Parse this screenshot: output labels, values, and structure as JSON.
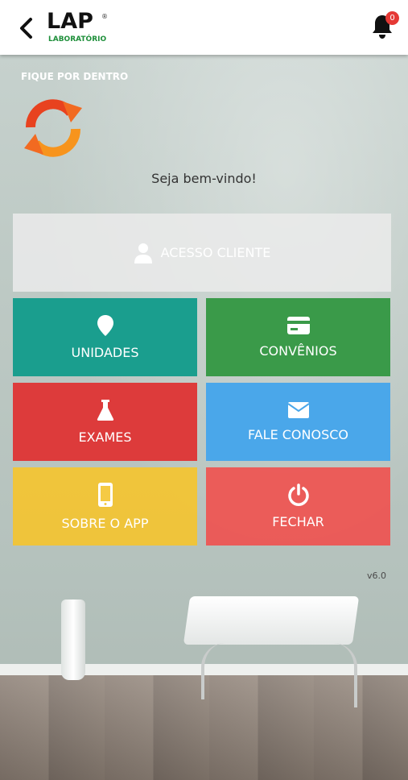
{
  "header": {
    "logo_main": "LAP",
    "logo_reg": "®",
    "logo_sub": "LABORATÓRIO",
    "notifications_count": "0"
  },
  "main": {
    "section_title": "FIQUE POR DENTRO",
    "welcome": "Seja bem-vindo!",
    "tiles": {
      "access": "ACESSO CLIENTE",
      "unidades": "UNIDADES",
      "convenios": "CONVÊNIOS",
      "exames": "EXAMES",
      "fale": "FALE CONOSCO",
      "sobre": "SOBRE O APP",
      "fechar": "FECHAR"
    },
    "version": "v6.0"
  },
  "colors": {
    "unidades": "#1a9e8e",
    "convenios": "#3a9a49",
    "exames": "#dd3b3b",
    "fale": "#4aa7ea",
    "sobre": "#f4c430",
    "fechar": "#ef5350",
    "logo_green": "#1e8f3a",
    "refresh_red": "#e53a1e",
    "refresh_orange": "#f7941d"
  },
  "icons": {
    "back": "chevron-left-icon",
    "bell": "bell-icon",
    "refresh": "refresh-icon",
    "user": "user-icon",
    "location": "location-pin-icon",
    "card": "credit-card-icon",
    "flask": "flask-icon",
    "mail": "envelope-icon",
    "phone": "phone-icon",
    "power": "power-icon"
  }
}
